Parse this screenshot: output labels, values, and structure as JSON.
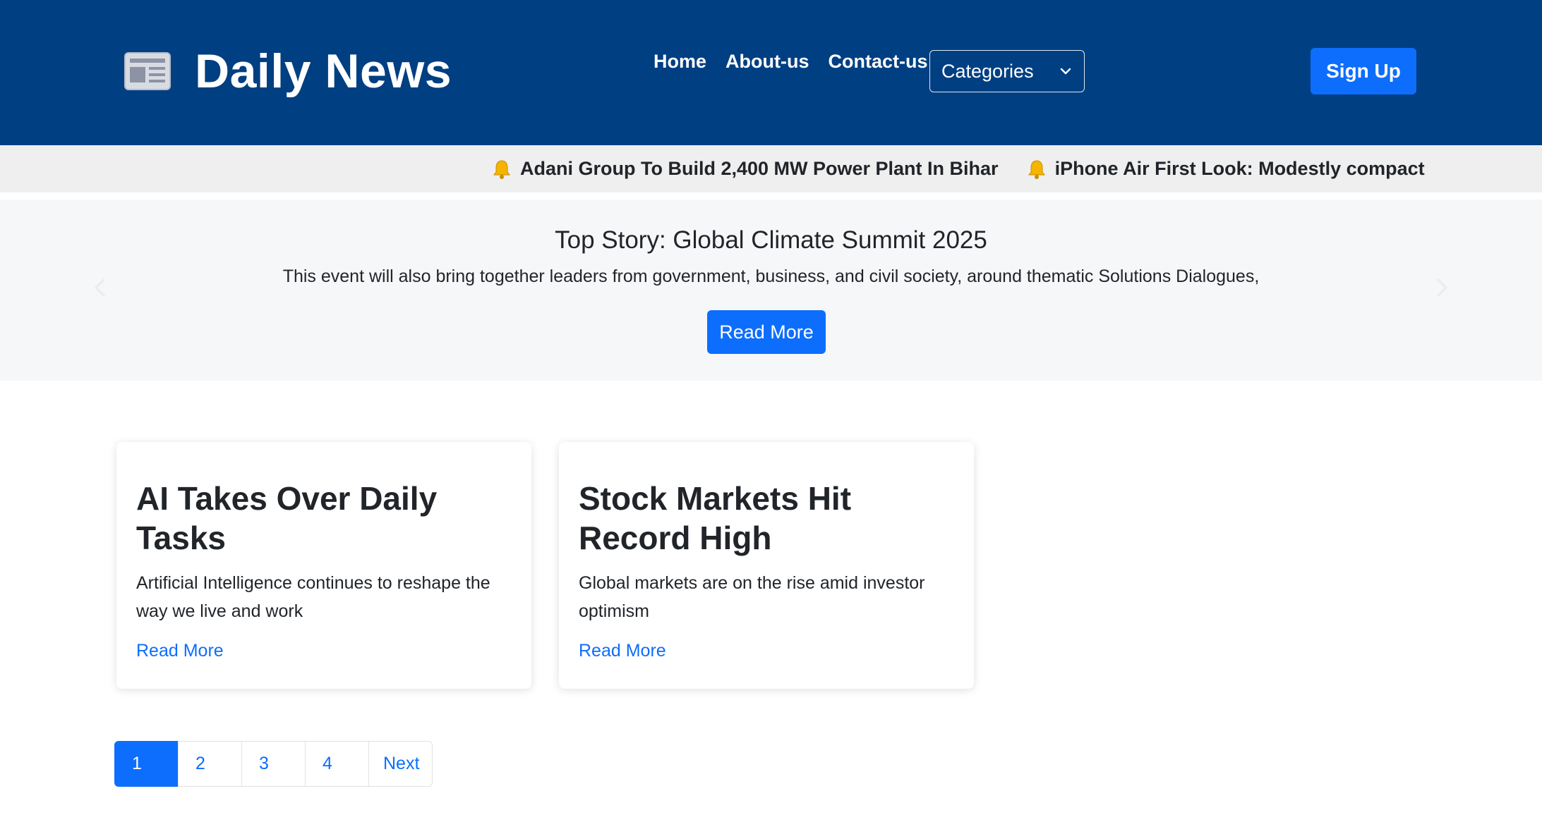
{
  "header": {
    "brand_title": "Daily News",
    "brand_icon": "newspaper-icon",
    "nav": [
      {
        "label": "Home"
      },
      {
        "label": "About-us"
      },
      {
        "label": "Contact-us"
      }
    ],
    "categories_select": {
      "selected": "Categories"
    },
    "signup_label": "Sign Up",
    "colors": {
      "header_bg": "#003f82",
      "accent": "#0d6efd"
    }
  },
  "ticker": {
    "items": [
      {
        "text": "Adani Group To Build 2,400 MW Power Plant In Bihar",
        "icon": "bell-icon"
      },
      {
        "text": "iPhone Air First Look: Modestly compact",
        "icon": "bell-icon"
      }
    ]
  },
  "hero": {
    "title": "Top Story: Global Climate Summit 2025",
    "text": "This event will also bring together leaders from government, business, and civil society, around thematic Solutions Dialogues,",
    "button_label": "Read More"
  },
  "cards": [
    {
      "title": "AI Takes Over Daily Tasks",
      "text": "Artificial Intelligence continues to reshape the way we live and work",
      "link": "Read More"
    },
    {
      "title": "Stock Markets Hit Record High",
      "text": "Global markets are on the rise amid investor optimism",
      "link": "Read More"
    }
  ],
  "pagination": {
    "pages": [
      "1",
      "2",
      "3",
      "4"
    ],
    "active": "1",
    "next_label": "Next"
  }
}
